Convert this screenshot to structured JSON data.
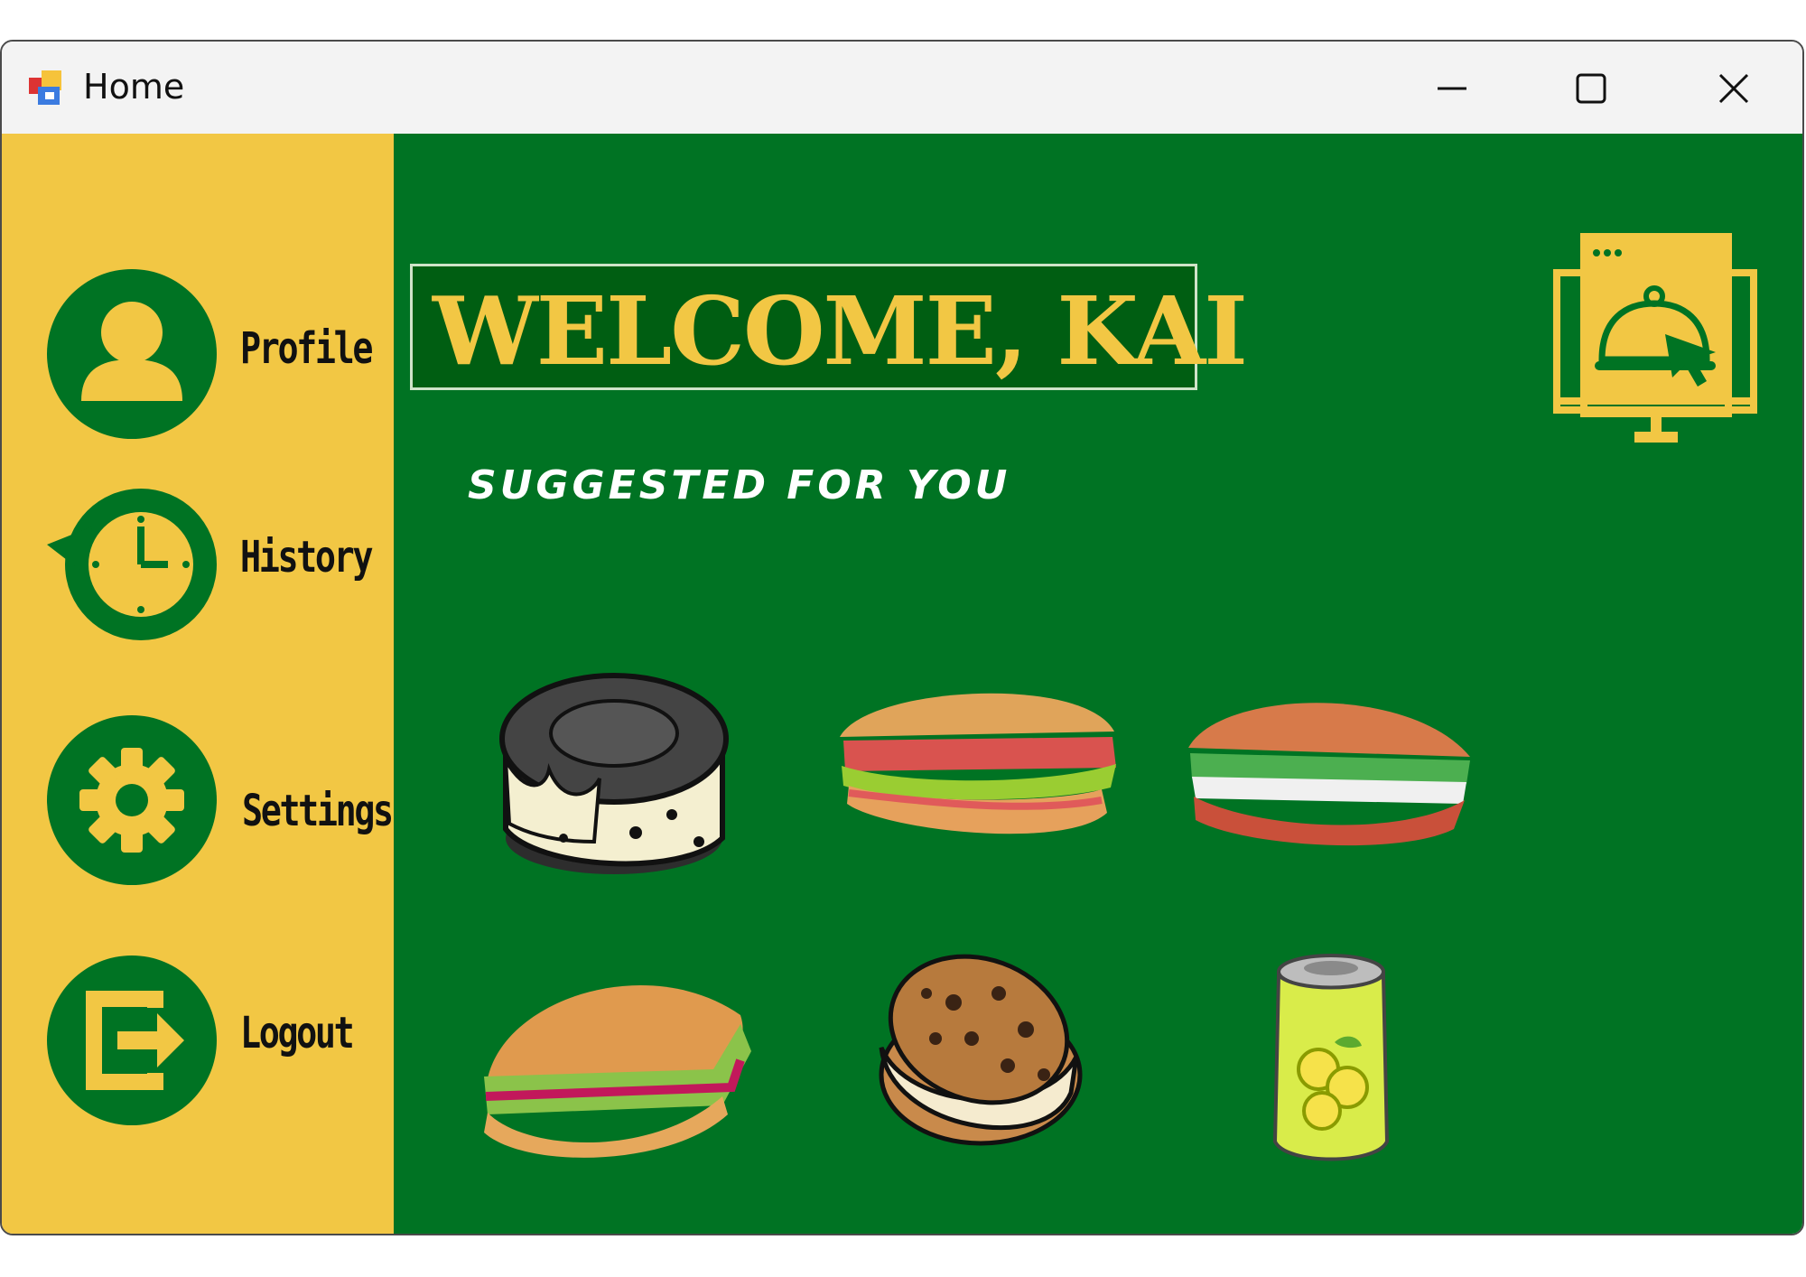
{
  "window": {
    "title": "Home"
  },
  "titlebar": {
    "minimize": "minimize-icon",
    "maximize": "maximize-icon",
    "close": "close-icon"
  },
  "sidebar": {
    "items": [
      {
        "label": "Profile",
        "icon": "user-icon"
      },
      {
        "label": "History",
        "icon": "history-clock-icon"
      },
      {
        "label": "Settings",
        "icon": "gear-icon"
      },
      {
        "label": "Logout",
        "icon": "logout-icon"
      }
    ]
  },
  "main": {
    "welcome": "WELCOME, KAI",
    "suggested_heading": "SUGGESTED FOR YOU",
    "suggestions": [
      {
        "icon": "cookie-ice-cream-sandwich-icon"
      },
      {
        "icon": "sub-sandwich-icon"
      },
      {
        "icon": "baguette-sandwich-icon"
      },
      {
        "icon": "hoagie-sandwich-icon"
      },
      {
        "icon": "chocolate-chip-ice-cream-sandwich-icon"
      },
      {
        "icon": "lemon-soda-can-icon"
      }
    ],
    "corner_icon": "online-food-order-icon"
  },
  "colors": {
    "sidebar": "#f2c744",
    "main": "#007323",
    "accent_yellow": "#f2c744",
    "dark_green": "#005e12"
  }
}
